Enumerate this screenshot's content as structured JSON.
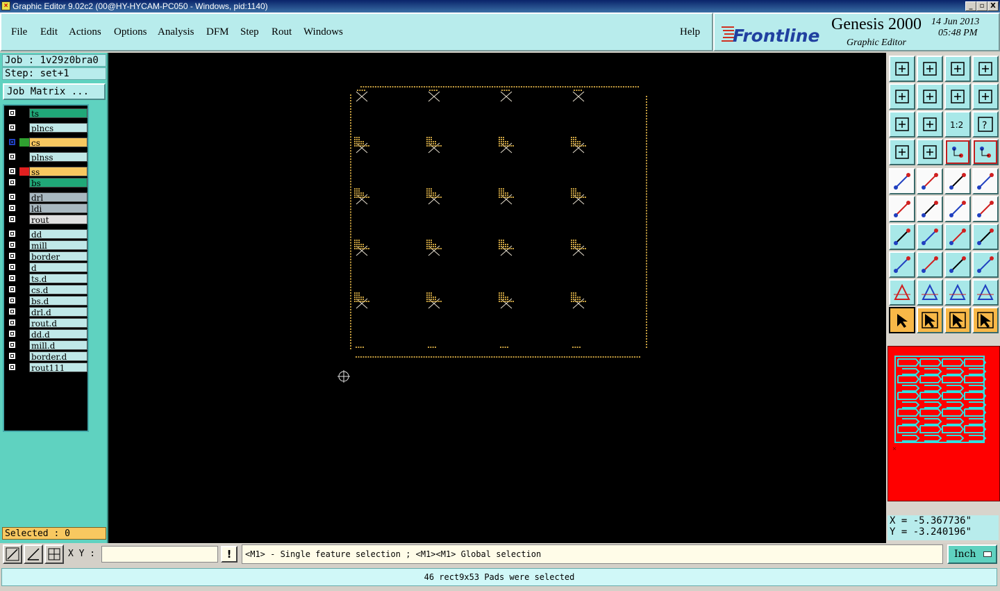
{
  "window": {
    "title": "Graphic Editor 9.02c2 (00@HY-HYCAM-PC050 - Windows, pid:1140)",
    "minimize": "_",
    "maximize": "▫",
    "close": "X"
  },
  "menu": {
    "file": "File",
    "edit": "Edit",
    "actions": "Actions",
    "options": "Options",
    "analysis": "Analysis",
    "dfm": "DFM",
    "step": "Step",
    "rout": "Rout",
    "windows": "Windows",
    "help": "Help"
  },
  "brand": {
    "logo": "Frontline",
    "product": "Genesis 2000",
    "subtitle": "Graphic Editor",
    "date": "14 Jun 2013",
    "time": "05:48 PM"
  },
  "job": {
    "job_label": "Job : 1v29z0bra0",
    "step_label": "Step: set+1",
    "matrix_button": "Job Matrix ..."
  },
  "layers": [
    {
      "name": "ts",
      "color": "#20a878",
      "swatch": "#000000",
      "checked": false
    },
    {
      "name": "plncs",
      "color": "#c0e8e8",
      "swatch": "#000000",
      "checked": false
    },
    {
      "name": "cs",
      "color": "#f8c860",
      "swatch": "#30a030",
      "checked": true
    },
    {
      "name": "plnss",
      "color": "#c0e8e8",
      "swatch": "#000000",
      "checked": false
    },
    {
      "name": "ss",
      "color": "#f8c860",
      "swatch": "#e02020",
      "checked": false
    },
    {
      "name": "bs",
      "color": "#20a878",
      "swatch": "#000000",
      "checked": false
    },
    {
      "name": "drl",
      "color": "#a8b8c0",
      "swatch": "#000000",
      "checked": false
    },
    {
      "name": "ldi",
      "color": "#a8b8c0",
      "swatch": "#000000",
      "checked": false
    },
    {
      "name": "rout",
      "color": "#e0e0e0",
      "swatch": "#000000",
      "checked": false
    },
    {
      "name": "dd",
      "color": "#c0e8e8",
      "swatch": "#000000",
      "checked": false
    },
    {
      "name": "mill",
      "color": "#c0e8e8",
      "swatch": "#000000",
      "checked": false
    },
    {
      "name": "border",
      "color": "#c0e8e8",
      "swatch": "#000000",
      "checked": false
    },
    {
      "name": "d",
      "color": "#c0e8e8",
      "swatch": "#000000",
      "checked": false
    },
    {
      "name": "ts.d",
      "color": "#c0e8e8",
      "swatch": "#000000",
      "checked": false
    },
    {
      "name": "cs.d",
      "color": "#c0e8e8",
      "swatch": "#000000",
      "checked": false
    },
    {
      "name": "bs.d",
      "color": "#c0e8e8",
      "swatch": "#000000",
      "checked": false
    },
    {
      "name": "drl.d",
      "color": "#c0e8e8",
      "swatch": "#000000",
      "checked": false
    },
    {
      "name": "rout.d",
      "color": "#c0e8e8",
      "swatch": "#000000",
      "checked": false
    },
    {
      "name": "dd.d",
      "color": "#c0e8e8",
      "swatch": "#000000",
      "checked": false
    },
    {
      "name": "mill.d",
      "color": "#c0e8e8",
      "swatch": "#000000",
      "checked": false
    },
    {
      "name": "border.d",
      "color": "#c0e8e8",
      "swatch": "#000000",
      "checked": false
    },
    {
      "name": "rout111",
      "color": "#c0e8e8",
      "swatch": "#000000",
      "checked": false
    }
  ],
  "selected_label": "Selected : 0",
  "canvas": {
    "feature_color": "#c8a040",
    "grid_cols": 4,
    "grid_rows": 5
  },
  "tools": {
    "icons": [
      "home-up-icon",
      "home-down-icon",
      "home-icon",
      "panel-split-icon",
      "pan-left-icon",
      "pan-right-icon",
      "undo-view-icon",
      "redo-view-icon",
      "zoom-fit-icon",
      "zoom-center-icon",
      "zoom-1to2-icon",
      "help-query-icon",
      "measure-tools-icon",
      "feature-key-icon",
      "net-red-icon",
      "net-red-2-icon",
      "add-pad-icon",
      "add-line-icon",
      "ruler-icon",
      "circle-select-icon",
      "net-blue-icon",
      "cross-delete-icon",
      "line-node-icon",
      "line-node-2-icon",
      "angle-icon",
      "slash-line-icon",
      "arc-icon",
      "text-icon",
      "pad-node-icon",
      "line-cut-icon",
      "resize-icon",
      "shape-icon",
      "triangle-red-icon",
      "triangle-blue-icon",
      "triangle-blue-2-icon",
      "triangle-blue-3-icon",
      "pointer-icon",
      "pointer-box-icon",
      "pointer-box-2-icon",
      "pointer-net-icon"
    ],
    "coord_x": "X = -5.367736\"",
    "coord_y": "Y = -3.240196\""
  },
  "bottom": {
    "xy_label": "X Y :",
    "xy_value": "",
    "excl": "!",
    "hint": "<M1> - Single feature selection ; <M1><M1> Global selection",
    "units": "Inch",
    "status": "46 rect9x53 Pads were selected"
  }
}
